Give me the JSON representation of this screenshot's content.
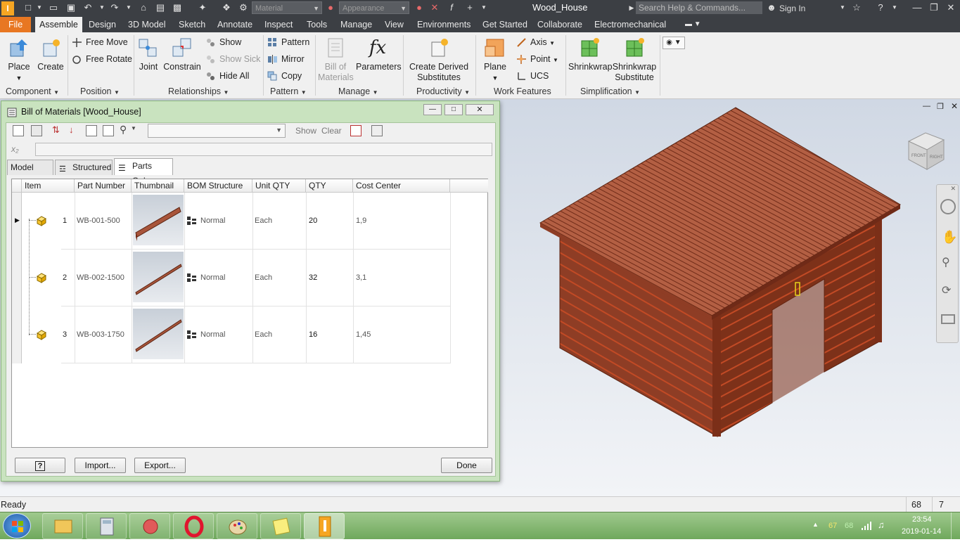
{
  "titlebar": {
    "material_placeholder": "Material",
    "appearance_placeholder": "Appearance",
    "document_title": "Wood_House",
    "search_placeholder": "Search Help & Commands...",
    "sign_in": "Sign In"
  },
  "menu": {
    "file": "File",
    "tabs": [
      "Assemble",
      "Design",
      "3D Model",
      "Sketch",
      "Annotate",
      "Inspect",
      "Tools",
      "Manage",
      "View",
      "Environments",
      "Get Started",
      "Collaborate",
      "Electromechanical"
    ],
    "active_tab": "Assemble"
  },
  "ribbon": {
    "place": "Place",
    "create": "Create",
    "free_move": "Free Move",
    "free_rotate": "Free Rotate",
    "joint": "Joint",
    "constrain": "Constrain",
    "show": "Show",
    "show_sick": "Show Sick",
    "hide_all": "Hide All",
    "pattern": "Pattern",
    "mirror": "Mirror",
    "copy": "Copy",
    "bill_of": "Bill of",
    "materials": "Materials",
    "parameters": "Parameters",
    "create_derived": "Create Derived",
    "substitutes": "Substitutes",
    "plane": "Plane",
    "axis": "Axis",
    "point": "Point",
    "ucs": "UCS",
    "shrinkwrap": "Shrinkwrap",
    "shrinkwrap_sub_1": "Shrinkwrap",
    "shrinkwrap_sub_2": "Substitute",
    "panels": {
      "component": "Component",
      "position": "Position",
      "relationships": "Relationships",
      "pattern": "Pattern",
      "manage": "Manage",
      "productivity": "Productivity",
      "work_features": "Work Features",
      "simplification": "Simplification"
    }
  },
  "bom_dialog": {
    "title": "Bill of Materials [Wood_House]",
    "show": "Show",
    "clear": "Clear",
    "tabs": [
      "Model Data",
      "Structured",
      "Parts Only"
    ],
    "active_tab": "Parts Only",
    "columns": [
      "Item",
      "Part Number",
      "Thumbnail",
      "BOM Structure",
      "Unit QTY",
      "QTY",
      "Cost Center"
    ],
    "rows": [
      {
        "item": "1",
        "part_number": "WB-001-500",
        "bom_structure": "Normal",
        "unit_qty": "Each",
        "qty": "20",
        "cost_center": "1,9"
      },
      {
        "item": "2",
        "part_number": "WB-002-1500",
        "bom_structure": "Normal",
        "unit_qty": "Each",
        "qty": "32",
        "cost_center": "3,1"
      },
      {
        "item": "3",
        "part_number": "WB-003-1750",
        "bom_structure": "Normal",
        "unit_qty": "Each",
        "qty": "16",
        "cost_center": "1,45"
      }
    ],
    "buttons": {
      "help": "?",
      "import": "Import...",
      "export": "Export...",
      "done": "Done"
    }
  },
  "status": {
    "text": "Ready",
    "count_a": "68",
    "count_b": "7"
  },
  "tray": {
    "num_a": "67",
    "num_b": "68",
    "time": "23:54",
    "date": "2019-01-14"
  },
  "viewcube": {
    "front": "FRONT",
    "right": "RIGHT"
  },
  "colors": {
    "accent_file": "#e87722",
    "wood": "#a8553b",
    "titlebar": "#3c3f44",
    "dialog_frame": "#c9e3bf"
  }
}
